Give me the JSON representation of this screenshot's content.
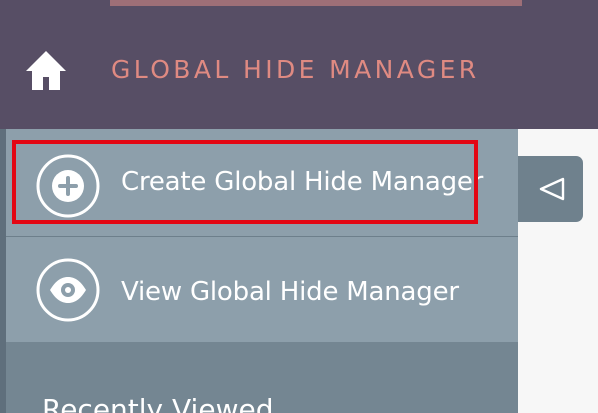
{
  "header": {
    "module_title": "GLOBAL HIDE MANAGER",
    "home_icon": "home-icon"
  },
  "sidebar": {
    "actions": [
      {
        "label": "Create Global Hide Manager",
        "icon": "plus-circle-icon",
        "highlighted": true
      },
      {
        "label": "View Global Hide Manager",
        "icon": "eye-icon",
        "highlighted": false
      }
    ],
    "recently_viewed_title": "Recently Viewed"
  },
  "collapse_toggle": {
    "icon": "triangle-left-icon"
  },
  "colors": {
    "header_bg": "#574e65",
    "title_text": "#df8a82",
    "sidebar_bg": "#8d9fab",
    "highlight_border": "#e30613"
  }
}
